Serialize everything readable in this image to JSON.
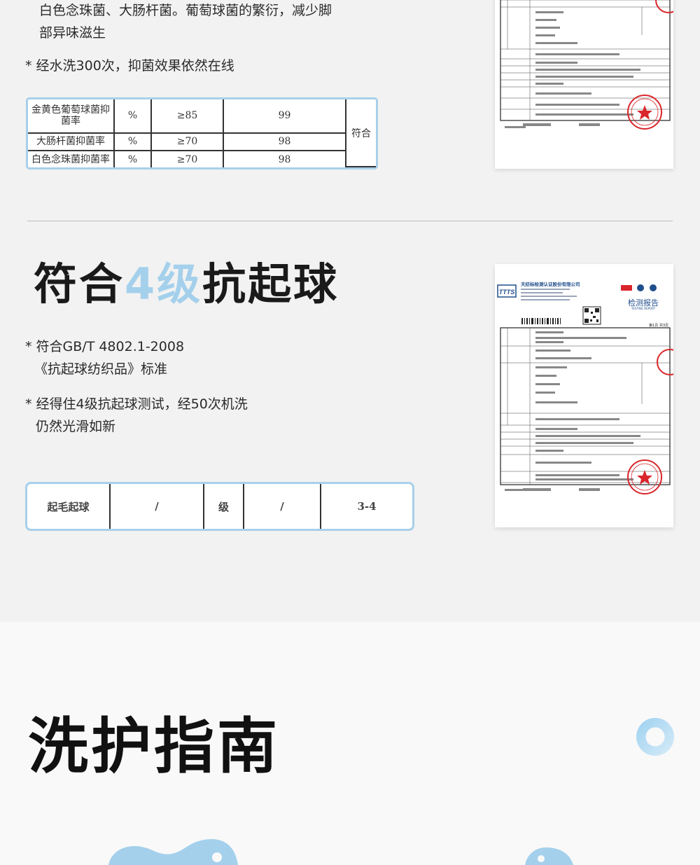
{
  "section1": {
    "text_continued": "白色念珠菌、大肠杆菌。葡萄球菌的繁衍，减少脚部异味滋生",
    "bullet": "* 经水洗300次，抑菌效果依然在线",
    "table": {
      "rows": [
        {
          "name": "金黄色葡萄球菌抑菌率",
          "unit": "%",
          "requirement": "≥85",
          "result": "99"
        },
        {
          "name": "大肠杆菌抑菌率",
          "unit": "%",
          "requirement": "≥70",
          "result": "98"
        },
        {
          "name": "白色念珠菌抑菌率",
          "unit": "%",
          "requirement": "≥70",
          "result": "98"
        }
      ],
      "verdict": "符合"
    }
  },
  "section2": {
    "heading_pre": "符合",
    "heading_accent": "4级",
    "heading_post": "抗起球",
    "bullet1_line1": "* 符合GB/T 4802.1-2008",
    "bullet1_line2": "《抗起球纺织品》标准",
    "bullet2_line1": "* 经得住4级抗起球测试，经50次机洗",
    "bullet2_line2": "仍然光滑如新",
    "table": {
      "cells": [
        "起毛起球",
        "/",
        "级",
        "/",
        "3-4"
      ]
    }
  },
  "report": {
    "company": "天纺标检测认证股份有限公司",
    "title": "检测报告",
    "title_en": "TESTING REPORT",
    "page": "第1页 共3页",
    "logo_text": "TTTS"
  },
  "section3": {
    "heading": "洗护指南"
  },
  "colors": {
    "accent": "#a4d0ec",
    "table_border": "#a7d0ea",
    "background": "#f2f2f2"
  }
}
